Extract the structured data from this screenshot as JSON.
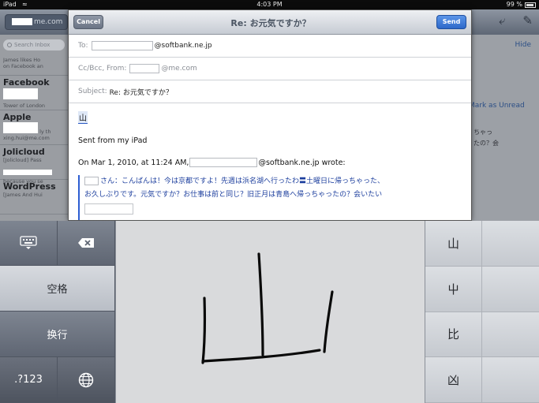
{
  "status_bar": {
    "device": "iPad",
    "time": "4:03 PM",
    "battery": "99 %"
  },
  "background": {
    "search_placeholder": "Search Inbox",
    "back_suffix": "me.com",
    "hide_label": "Hide",
    "mark_unread_label": "Mark as Unread",
    "inbox": [
      {
        "sender": "",
        "line1": "James likes Ho",
        "line2": "on Facebook an"
      },
      {
        "sender": "Facebook",
        "line1": "",
        "line2": "Tower of London"
      },
      {
        "sender": "Apple",
        "line1": "ly th",
        "line2": "xing.hui@me.com"
      },
      {
        "sender": "Jolicloud",
        "line1": "[Jolicloud] Pass",
        "line2": "because you se"
      },
      {
        "sender": "WordPress",
        "line1": "[James And Hui",
        "line2": ""
      }
    ],
    "right_snippets": [
      "ちゃっ",
      "たの？会"
    ]
  },
  "compose": {
    "cancel_label": "Cancel",
    "title": "Re: お元気ですか？",
    "send_label": "Send",
    "to_label": "To:",
    "to_domain": "@softbank.ne.jp",
    "cc_label": "Cc/Bcc, From:",
    "from_domain": "@me.com",
    "subject_label": "Subject:",
    "subject_value": "Re: お元気ですか？",
    "body_char": "山",
    "signature": "Sent from my iPad",
    "wrote_prefix": "On Mar 1, 2010, at 11:24 AM,",
    "wrote_suffix": "@softbank.ne.jp wrote:",
    "quote_line1": "さん：こんばんは！今は京都ですよ！先週は浜名湖へ行ったわ〓土曜日に帰っちゃった、",
    "quote_line2": "お久しぶりです。元気ですか？お仕事は前と同じ？旧正月は青島へ帰っちゃったの？会いたい"
  },
  "keyboard": {
    "space_label": "空格",
    "return_label": "换行",
    "numbers_label": ".?123",
    "keyboard_icon": "keyboard-hide-icon",
    "delete_icon": "backspace-icon",
    "globe_icon": "globe-icon",
    "candidates": [
      "山",
      "屮",
      "比",
      "凶"
    ]
  }
}
